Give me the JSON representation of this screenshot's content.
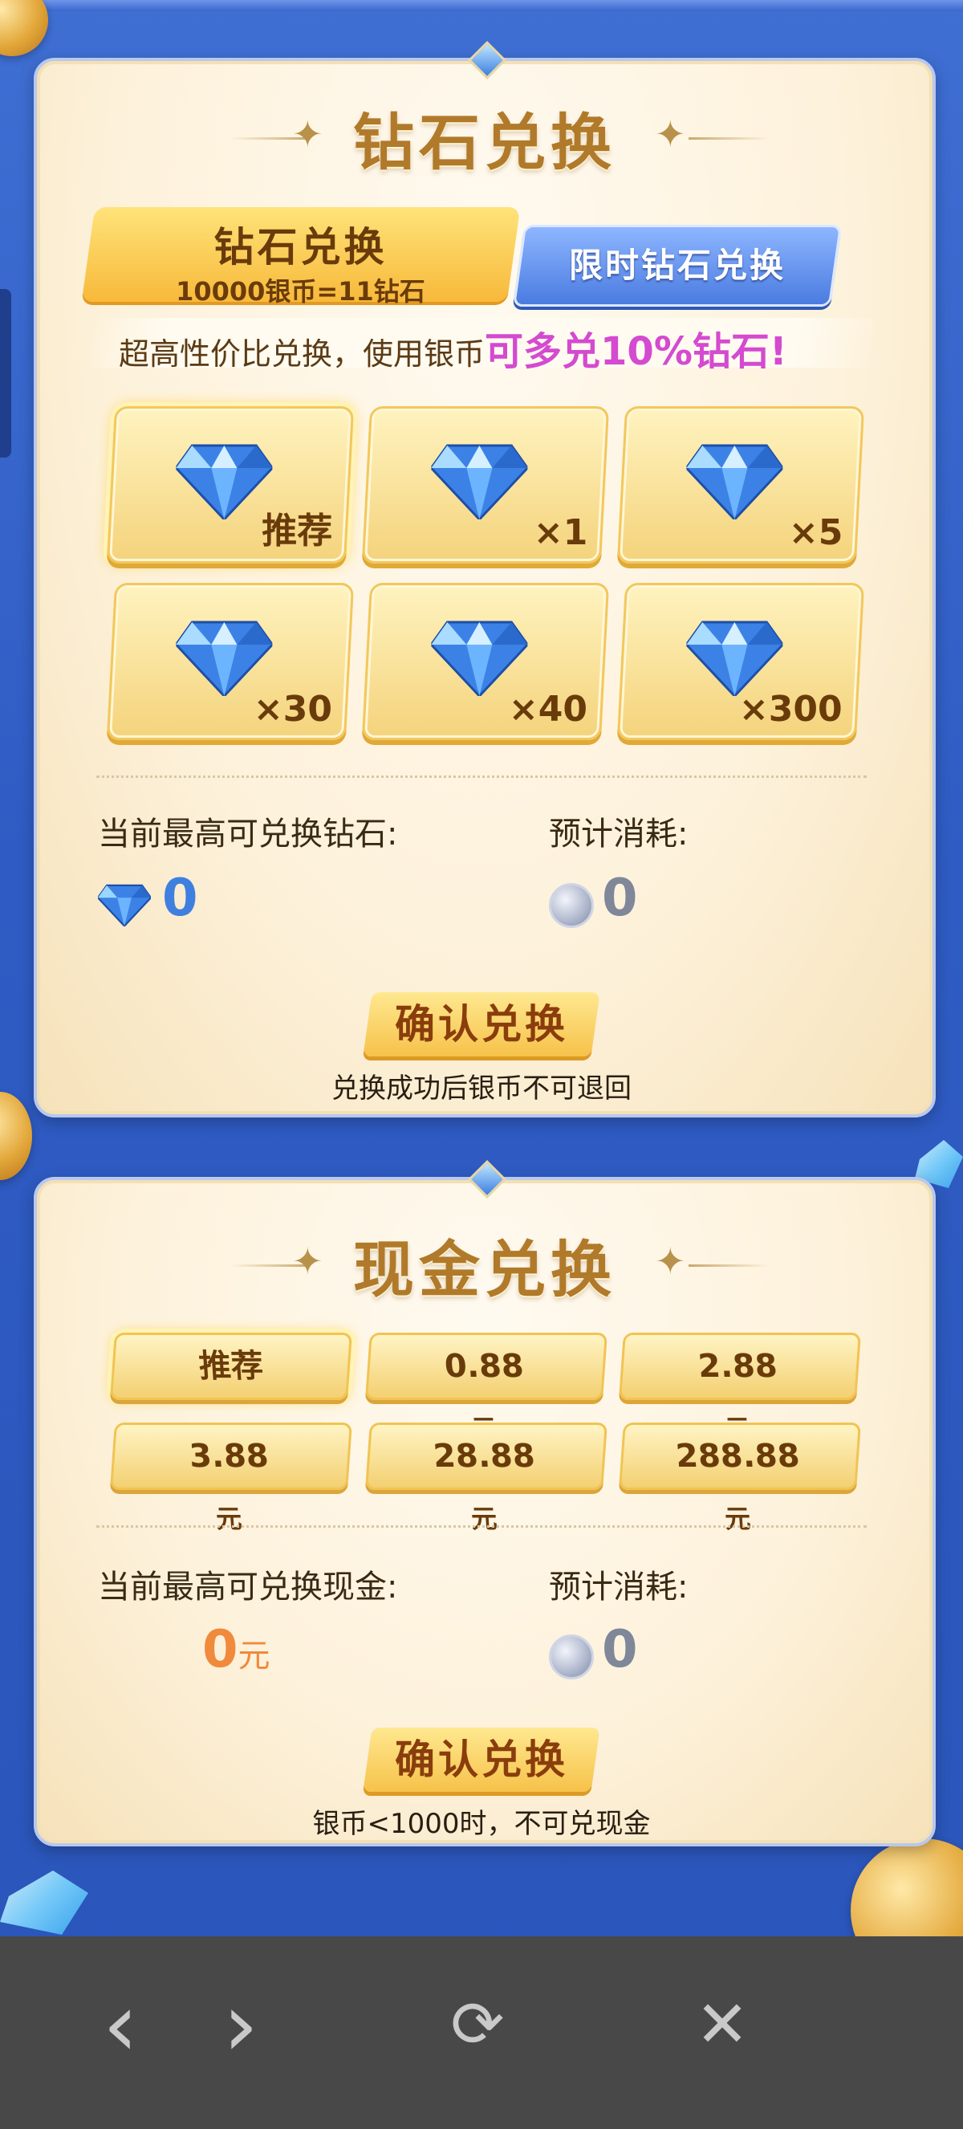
{
  "diamond_panel": {
    "title": "钻石兑换",
    "tabs": [
      {
        "label": "钻石兑换",
        "sub": "10000银币=11钻石",
        "active": true
      },
      {
        "label": "限时钻石兑换",
        "active": false
      }
    ],
    "promo_prefix": "超高性价比兑换，使用银币",
    "promo_highlight": "可多兑10%钻石!",
    "options": [
      "推荐",
      "×1",
      "×5",
      "×30",
      "×40",
      "×300"
    ],
    "max_label": "当前最高可兑换钻石:",
    "max_value": "0",
    "cost_label": "预计消耗:",
    "cost_value": "0",
    "confirm_label": "确认兑换",
    "note": "兑换成功后银币不可退回"
  },
  "cash_panel": {
    "title": "现金兑换",
    "options": [
      {
        "amount": "推荐",
        "unit": ""
      },
      {
        "amount": "0.88",
        "unit": "元"
      },
      {
        "amount": "2.88",
        "unit": "元"
      },
      {
        "amount": "3.88",
        "unit": "元"
      },
      {
        "amount": "28.88",
        "unit": "元"
      },
      {
        "amount": "288.88",
        "unit": "元"
      }
    ],
    "max_label": "当前最高可兑换现金:",
    "max_value": "0",
    "max_unit": "元",
    "cost_label": "预计消耗:",
    "cost_value": "0",
    "confirm_label": "确认兑换",
    "note": "银币<1000时，不可兑现金"
  },
  "nav": {
    "back_icon": "‹",
    "forward_icon": "›",
    "reload_icon": "⟳",
    "close_icon": "✕"
  },
  "colors": {
    "accent_gold": "#f6c24a",
    "promo_pink": "#d44ad0",
    "cash_orange": "#f08a3c",
    "diamond_blue": "#3c7ee0"
  }
}
